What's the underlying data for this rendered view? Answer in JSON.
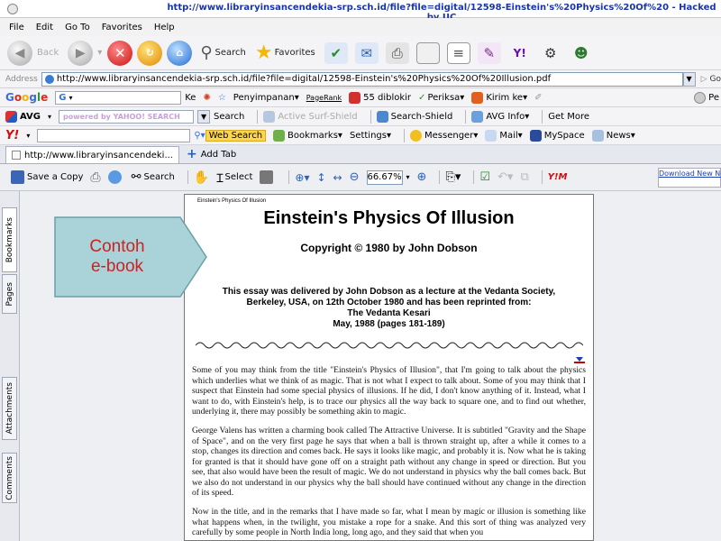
{
  "window": {
    "title": "http://www.libraryinsancendekia-srp.sch.id/file?file=digital/12598-Einstein's%20Physics%20Of%20 - Hacked by UC"
  },
  "menu": [
    "File",
    "Edit",
    "Go To",
    "Favorites",
    "Help"
  ],
  "nav": {
    "back": "Back",
    "search": "Search",
    "favorites": "Favorites"
  },
  "address": {
    "label": "Address",
    "url": "http://www.libraryinsancendekia-srp.sch.id/file?file=digital/12598-Einstein's%20Physics%20Of%20Illusion.pdf",
    "go": "Go"
  },
  "google_bar": {
    "brand": "Google",
    "items": [
      "Ke",
      "Penyimpanan",
      "PageRank",
      "55 diblokir",
      "Periksa",
      "Kirim ke"
    ],
    "right": "Pe"
  },
  "avg_bar": {
    "brand": "AVG",
    "search_placeholder": "powered by YAHOO! SEARCH",
    "search": "Search",
    "active_surf": "Active Surf-Shield",
    "search_shield": "Search-Shield",
    "avg_info": "AVG Info",
    "get_more": "Get More"
  },
  "yahoo_bar": {
    "brand": "Y!",
    "web_search": "Web Search",
    "items": [
      "Bookmarks",
      "Settings",
      "Messenger",
      "Mail",
      "MySpace",
      "News"
    ]
  },
  "tabs": {
    "active": "http://www.libraryinsancendeki...",
    "add": "Add Tab"
  },
  "pdf_toolbar": {
    "save": "Save a Copy",
    "search": "Search",
    "select": "Select",
    "zoom": "66.67%",
    "download": "Download New Now"
  },
  "sidebar_tabs": [
    "Bookmarks",
    "Pages",
    "Attachments",
    "Comments"
  ],
  "callout": {
    "line1": "Contoh",
    "line2": "e-book"
  },
  "document": {
    "header_small": "Einstein's Physics Of Illusion",
    "title": "Einstein's Physics Of Illusion",
    "copyright": "Copyright © 1980 by John Dobson",
    "intro": [
      "This essay was delivered by John Dobson as a lecture at the Vedanta Society,",
      "Berkeley, USA, on 12th October 1980 and has been reprinted from:",
      "The Vedanta Kesari",
      "May, 1988 (pages 181-189)"
    ],
    "paragraphs": [
      "Some of you may think from the title \"Einstein's Physics of Illusion\", that I'm going to talk about the physics which underlies what we think of as magic. That is not what I expect to talk about. Some of you may think that I suspect that Einstein had some special physics of illusions. If he did, I don't know anything of it. Instead, what I want to do, with Einstein's help, is to trace our physics all the way back to square one, and to find out whether, underlying it, there may possibly be something akin to magic.",
      "George Valens has written a charming book called The Attractive Universe. It is subtitled \"Gravity and the Shape of Space\", and on the very first page he says that when a ball is thrown straight up, after a while it comes to a stop, changes its direction and comes back. He says it looks like magic, and probably it is. Now what he is taking for granted is that it should have gone off on a straight path without any change in speed or direction. But you see, that also would have been the result of magic. We do not understand in physics why the ball comes back. But we also do not understand in our physics why the ball should have continued without any change in the direction of its speed.",
      "Now in the title, and in the remarks that I have made so far, what I mean by magic or illusion is something like what happens when, in the twilight, you mistake a rope for a snake. And this sort of thing was analyzed very carefully by some people in North India long, long ago, and they said that when you"
    ]
  }
}
